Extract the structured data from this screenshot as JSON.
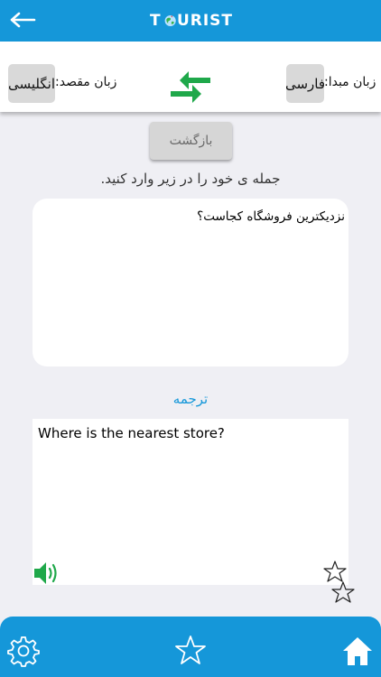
{
  "header": {
    "back_icon": "arrow-left-icon",
    "logo_letter_1": "T",
    "logo_rest": "URIST",
    "logo_icon": "globe-icon"
  },
  "languages": {
    "source_caption": "زبان مبدا:",
    "source_value": "فارسی",
    "target_caption": "زبان مقصد:",
    "target_value": "انگلیسی",
    "swap_icon": "swap-arrows-icon"
  },
  "main": {
    "back_button": "بازگشت",
    "instruction": "جمله ی خود را در زیر وارد کنید.",
    "input_text": "نزدیکترین فروشگاه کجاست؟",
    "translate_label": "ترجمه",
    "output_text": "Where is the nearest store?",
    "speaker_icon": "speaker-icon",
    "favorite_icon": "star-icon"
  },
  "bottom_nav": {
    "settings_icon": "gear-icon",
    "favorites_icon": "star-icon",
    "home_icon": "home-icon"
  },
  "colors": {
    "primary": "#1597d9",
    "swap_green": "#1fa84a",
    "background": "#efeff4"
  }
}
